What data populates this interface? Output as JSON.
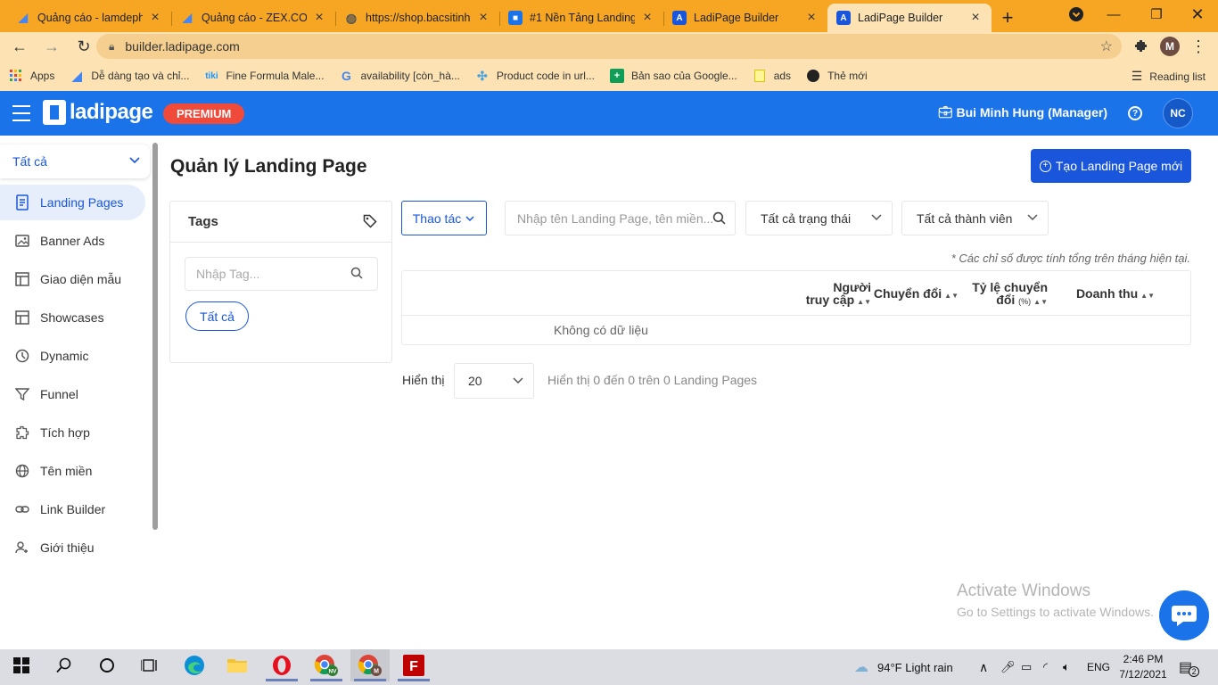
{
  "browser": {
    "tabs": [
      {
        "title": "Quảng cáo - lamdeph",
        "favicon": "google-ads-icon",
        "active": false
      },
      {
        "title": "Quảng cáo - ZEX.COM",
        "favicon": "google-ads-icon",
        "active": false
      },
      {
        "title": "https://shop.bacsitinh",
        "favicon": "globe-icon",
        "active": false
      },
      {
        "title": "#1 Nền Tảng Landing",
        "favicon": "ladipage-icon",
        "active": false
      },
      {
        "title": "LadiPage Builder",
        "favicon": "ladipage-builder-icon",
        "active": false
      },
      {
        "title": "LadiPage Builder",
        "favicon": "ladipage-builder-icon",
        "active": true
      }
    ],
    "new_tab": "+",
    "url": "builder.ladipage.com",
    "profile_initial": "M",
    "bookmarks": [
      {
        "label": "Apps",
        "icon": "apps-grid-icon"
      },
      {
        "label": "Dễ dàng tạo và chỉ...",
        "icon": "google-ads-icon"
      },
      {
        "label": "Fine Formula Male...",
        "icon": "tiki-icon"
      },
      {
        "label": "availability [còn_hà...",
        "icon": "google-icon"
      },
      {
        "label": "Product code in url...",
        "icon": "pinwheel-icon"
      },
      {
        "label": "Bản sao của Google...",
        "icon": "sheets-icon"
      },
      {
        "label": "ads",
        "icon": "folder-icon"
      },
      {
        "label": "Thẻ mới",
        "icon": "globe-icon"
      }
    ],
    "reading_list": "Reading list"
  },
  "header": {
    "logo_text": "ladipage",
    "badge": "PREMIUM",
    "user": "Bui Minh Hung (Manager)",
    "avatar_initials": "NC"
  },
  "sidebar": {
    "filter": "Tất cả",
    "items": [
      {
        "label": "Landing Pages",
        "icon": "document-icon",
        "active": true
      },
      {
        "label": "Banner Ads",
        "icon": "image-icon",
        "active": false
      },
      {
        "label": "Giao diện mẫu",
        "icon": "layout-icon",
        "active": false
      },
      {
        "label": "Showcases",
        "icon": "showcase-icon",
        "active": false
      },
      {
        "label": "Dynamic",
        "icon": "dynamic-icon",
        "active": false
      },
      {
        "label": "Funnel",
        "icon": "funnel-icon",
        "active": false
      },
      {
        "label": "Tích hợp",
        "icon": "puzzle-icon",
        "active": false
      },
      {
        "label": "Tên miền",
        "icon": "globe-icon",
        "active": false
      },
      {
        "label": "Link Builder",
        "icon": "link-icon",
        "active": false
      },
      {
        "label": "Giới thiệu",
        "icon": "user-add-icon",
        "active": false
      }
    ]
  },
  "main": {
    "title": "Quản lý Landing Page",
    "create_button": "Tạo Landing Page mới",
    "tags": {
      "title": "Tags",
      "search_placeholder": "Nhập Tag...",
      "all_chip": "Tất cả"
    },
    "actions_label": "Thao tác",
    "search_placeholder": "Nhập tên Landing Page, tên miền...",
    "status_filter": "Tất cả trạng thái",
    "member_filter": "Tất cả thành viên",
    "note": "* Các chỉ số được tính tổng trên tháng hiện tại.",
    "table": {
      "columns": [
        {
          "line1": "Người",
          "line2": "truy cập"
        },
        {
          "line1": "Chuyển đổi",
          "line2": ""
        },
        {
          "line1": "Tỷ lệ chuyển",
          "line2": "đổi",
          "unit": "(%)"
        },
        {
          "line1": "Doanh thu",
          "line2": ""
        }
      ],
      "empty_text": "Không có dữ liệu"
    },
    "pagination": {
      "label": "Hiển thị",
      "page_size": "20",
      "info": "Hiển thị 0 đến 0 trên 0 Landing Pages"
    }
  },
  "watermark": {
    "line1": "Activate Windows",
    "line2": "Go to Settings to activate Windows."
  },
  "taskbar": {
    "weather": "94°F  Light rain",
    "language": "ENG",
    "time": "2:46 PM",
    "date": "7/12/2021",
    "notifications": "2"
  },
  "colors": {
    "accent": "#1a56db",
    "header_blue": "#1a73e8",
    "premium_red": "#f04a3a",
    "tabbar_orange": "#f6a623"
  }
}
